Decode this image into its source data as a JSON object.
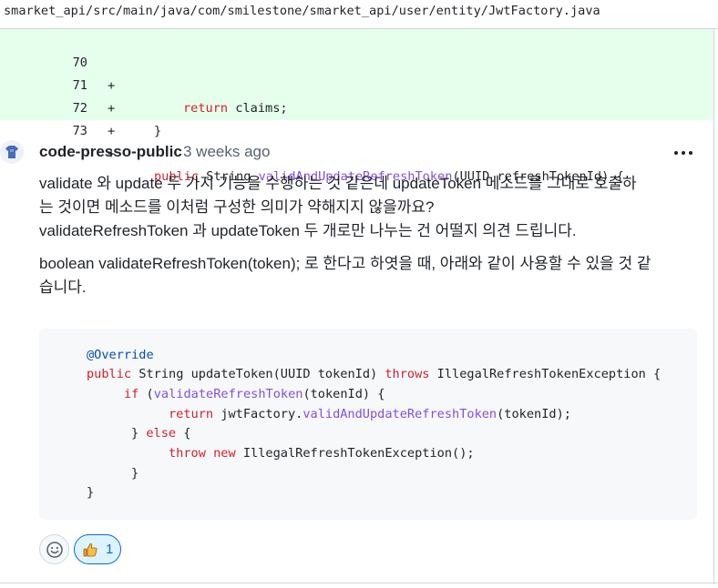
{
  "file": {
    "path": "smarket_api/src/main/java/com/smilestone/smarket_api/user/entity/JwtFactory.java"
  },
  "diff": {
    "lines": [
      {
        "number": "70",
        "sign": "+"
      },
      {
        "number": "71",
        "sign": "+"
      },
      {
        "number": "72",
        "sign": "+"
      },
      {
        "number": "73",
        "sign": "+"
      }
    ],
    "line70": {
      "kw": "return",
      "rest": " claims;"
    },
    "line71": {
      "text": "}"
    },
    "line73": {
      "kw": "public",
      "type": " String ",
      "fn": "validAndUpdateRefreshToken",
      "rest": "(UUID refreshTokenId) {"
    }
  },
  "comment": {
    "author": "code-presso-public",
    "time": "3 weeks ago",
    "paragraph1_line1": "validate 와 update 두 가지 기능을 수행하는 것 같은데 updateToken 메소드를 그대로 호출하",
    "paragraph1_line2": "는 것이면 메소드를 이처럼 구성한 의미가 약해지지 않을까요?",
    "paragraph1_line3": "validateRefreshToken 과 updateToken 두 개로만 나누는 건 어떨지 의견 드립니다.",
    "paragraph2_line1": "boolean validateRefreshToken(token); 로 한다고 하엿을 때, 아래와 같이 사용할 수 있을 것 같",
    "paragraph2_line2": "습니다."
  },
  "codeblock": {
    "l1": "@Override",
    "l2_kw": "public",
    "l2_a": " String updateToken(UUID tokenId) ",
    "l2_kw2": "throws",
    "l2_b": " IllegalRefreshTokenException {",
    "l3_kw": "if",
    "l3_a": " (",
    "l3_fn": "validateRefreshToken",
    "l3_b": "(tokenId) {",
    "l4_kw": "return",
    "l4_a": " jwtFactory.",
    "l4_fn": "validAndUpdateRefreshToken",
    "l4_b": "(tokenId);",
    "l5_a": "} ",
    "l5_kw": "else",
    "l5_b": " {",
    "l6_kw": "throw",
    "l6_kw2": "new",
    "l6_b": " IllegalRefreshTokenException();",
    "l7": "}",
    "l8": "}"
  },
  "reactions": {
    "add_icon": "smiley-icon",
    "thumbs_icon": "thumbs-up-icon",
    "thumbs_count": "1"
  },
  "colors": {
    "diff_added_bg": "#e6ffec",
    "keyword": "#cf222e",
    "function": "#8250df",
    "annotation": "#0550ae",
    "reaction_active": "#0969da"
  }
}
